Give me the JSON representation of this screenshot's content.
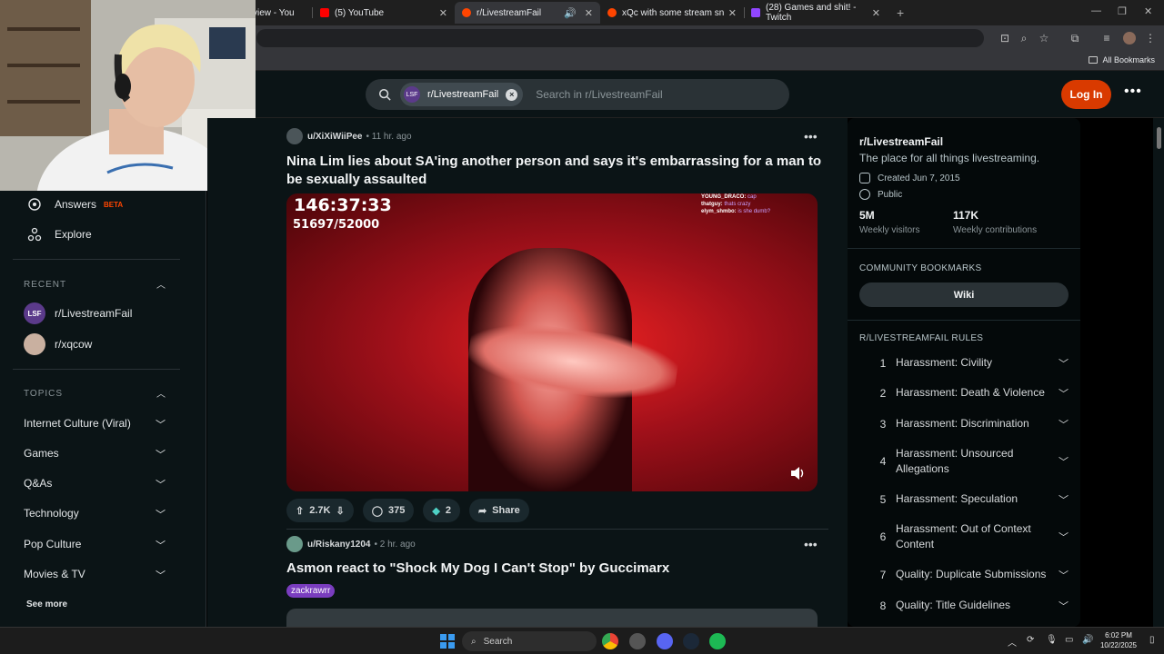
{
  "browser": {
    "tabs": [
      {
        "title": "view - You",
        "active": false
      },
      {
        "title": "(5) YouTube",
        "active": false
      },
      {
        "title": "r/LivestreamFail",
        "active": true
      },
      {
        "title": "xQc with some stream snipers",
        "active": false
      },
      {
        "title": "(28) Games and shit! - Twitch",
        "active": false
      }
    ],
    "new_tab": "+",
    "all_bookmarks": "All Bookmarks",
    "colors": {
      "youtube": "#ff0000",
      "reddit": "#ff4500",
      "twitch": "#9146ff"
    }
  },
  "header": {
    "search_chip": "r/LivestreamFail",
    "search_chip_avatar": "LSF",
    "search_placeholder": "Search in r/LivestreamFail",
    "login_label": "Log In",
    "more": "•••"
  },
  "left_sidebar": {
    "nav": [
      {
        "label": "Answers",
        "badge": "BETA",
        "icon": "answers-icon"
      },
      {
        "label": "Explore",
        "icon": "explore-icon"
      }
    ],
    "recent_title": "RECENT",
    "recent": [
      {
        "label": "r/LivestreamFail",
        "avatar": "LSF"
      },
      {
        "label": "r/xqcow",
        "avatar": ""
      }
    ],
    "topics_title": "TOPICS",
    "topics": [
      "Internet Culture (Viral)",
      "Games",
      "Q&As",
      "Technology",
      "Pop Culture",
      "Movies & TV"
    ],
    "see_more": "See more"
  },
  "feed": {
    "posts": [
      {
        "user": "u/XiXiWiiPee",
        "time": "• 11 hr. ago",
        "title": "Nina Lim lies about SA'ing another person and says it's embarrassing for a man to be sexually assaulted",
        "video": {
          "timer": "146:37:33",
          "counter": "51697/52000",
          "chat": [
            {
              "name": "YOUNG_DRACO:",
              "text": "cap"
            },
            {
              "name": "thatguy:",
              "text": "thats crazy"
            },
            {
              "name": "elym_shmbo:",
              "text": "is she dumb?"
            }
          ]
        },
        "upvotes": "2.7K",
        "comments": "375",
        "awards": "2",
        "share": "Share"
      },
      {
        "user": "u/Riskany1204",
        "time": "• 2 hr. ago",
        "title": "Asmon react to \"Shock My Dog I Can't Stop\" by Guccimarx",
        "flair": "zackrawrr"
      }
    ]
  },
  "right_sidebar": {
    "name": "r/LivestreamFail",
    "description": "The place for all things livestreaming.",
    "created": "Created Jun 7, 2015",
    "visibility": "Public",
    "stats": [
      {
        "value": "5M",
        "label": "Weekly visitors"
      },
      {
        "value": "117K",
        "label": "Weekly contributions"
      }
    ],
    "bookmarks_title": "COMMUNITY BOOKMARKS",
    "wiki": "Wiki",
    "rules_title": "R/LIVESTREAMFAIL RULES",
    "rules": [
      {
        "n": "1",
        "text": "Harassment: Civility"
      },
      {
        "n": "2",
        "text": "Harassment: Death & Violence"
      },
      {
        "n": "3",
        "text": "Harassment: Discrimination"
      },
      {
        "n": "4",
        "text": "Harassment: Unsourced Allegations"
      },
      {
        "n": "5",
        "text": "Harassment: Speculation"
      },
      {
        "n": "6",
        "text": "Harassment: Out of Context Content"
      },
      {
        "n": "7",
        "text": "Quality: Duplicate Submissions"
      },
      {
        "n": "8",
        "text": "Quality: Title Guidelines"
      }
    ]
  },
  "taskbar": {
    "search": "Search",
    "time": "6:02 PM",
    "date": "10/22/2025"
  }
}
